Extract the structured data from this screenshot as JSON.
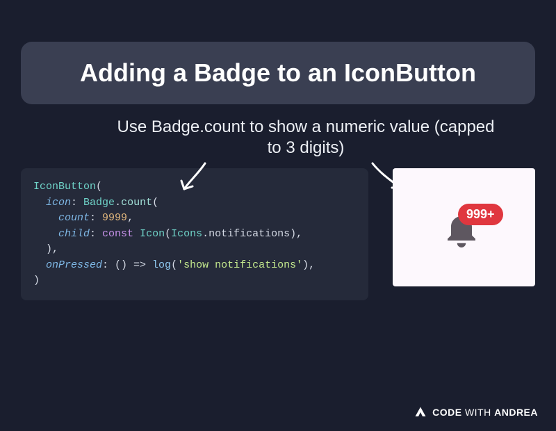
{
  "title": "Adding a Badge to an IconButton",
  "subtitle": "Use Badge.count to show a numeric value (capped to 3 digits)",
  "code": {
    "l1a": "IconButton",
    "l1b": "(",
    "l2a": "  ",
    "l2b": "icon",
    "l2c": ": ",
    "l2d": "Badge",
    "l2e": ".",
    "l2f": "count",
    "l2g": "(",
    "l3a": "    ",
    "l3b": "count",
    "l3c": ": ",
    "l3d": "9999",
    "l3e": ",",
    "l4a": "    ",
    "l4b": "child",
    "l4c": ": ",
    "l4d": "const",
    "l4e": " ",
    "l4f": "Icon",
    "l4g": "(",
    "l4h": "Icons",
    "l4i": ".notifications),",
    "l5": "  ),",
    "l6a": "  ",
    "l6b": "onPressed",
    "l6c": ": () => ",
    "l6d": "log",
    "l6e": "(",
    "l6f": "'show notifications'",
    "l6g": "),",
    "l7": ")"
  },
  "badge_text": "999+",
  "footer": {
    "brand1": "CODE",
    "brand2": " WITH ",
    "brand3": "ANDREA"
  }
}
